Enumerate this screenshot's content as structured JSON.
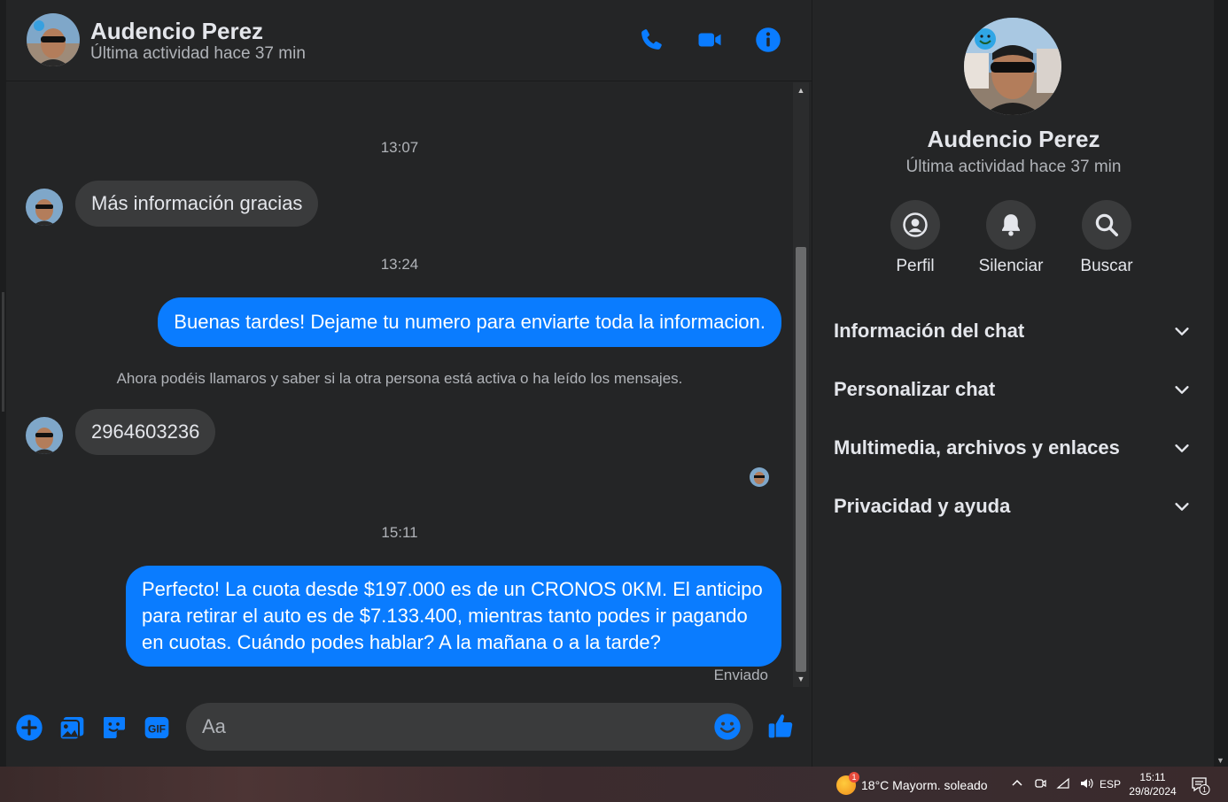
{
  "contact": {
    "name": "Audencio Perez",
    "status": "Última actividad hace 37 min"
  },
  "header_actions": [
    "phone-icon",
    "video-icon",
    "info-icon"
  ],
  "messages": [
    {
      "type": "time",
      "text": "13:07"
    },
    {
      "type": "in",
      "text": "Más información  gracias"
    },
    {
      "type": "time",
      "text": "13:24"
    },
    {
      "type": "out",
      "text": "Buenas tardes! Dejame tu numero para enviarte toda la informacion."
    },
    {
      "type": "system",
      "text": "Ahora podéis llamaros y saber si la otra persona está activa o ha leído los mensajes."
    },
    {
      "type": "in",
      "text": "2964603236"
    },
    {
      "type": "time",
      "text": "15:11"
    },
    {
      "type": "out",
      "text": "Perfecto! La cuota desde $197.000 es de un CRONOS 0KM. El anticipo para retirar el auto es de $7.133.400, mientras tanto podes ir pagando en cuotas. Cuándo podes hablar? A la mañana o a la tarde?"
    },
    {
      "type": "status",
      "text": "Enviado"
    }
  ],
  "composer": {
    "placeholder": "Aa",
    "buttons": [
      "plus-icon",
      "image-icon",
      "sticker-icon",
      "gif-icon"
    ],
    "gif_label": "GIF"
  },
  "info_panel": {
    "name": "Audencio Perez",
    "status": "Última actividad hace 37 min",
    "actions": [
      {
        "label": "Perfil",
        "icon": "profile-icon"
      },
      {
        "label": "Silenciar",
        "icon": "bell-icon"
      },
      {
        "label": "Buscar",
        "icon": "search-icon"
      }
    ],
    "sections": [
      {
        "label": "Información del chat"
      },
      {
        "label": "Personalizar chat"
      },
      {
        "label": "Multimedia, archivos y enlaces"
      },
      {
        "label": "Privacidad y ayuda"
      }
    ]
  },
  "taskbar": {
    "weather_badge": "1",
    "weather": "18°C  Mayorm. soleado",
    "language": "ESP",
    "time": "15:11",
    "date": "29/8/2024",
    "notification_count": "1"
  },
  "colors": {
    "accent": "#0a7cff",
    "background": "#242526",
    "bubble_in": "#3a3b3c"
  }
}
